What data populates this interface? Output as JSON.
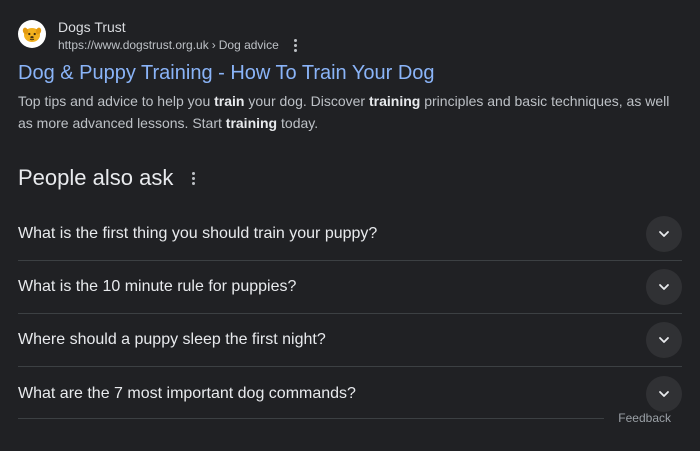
{
  "result": {
    "site_name": "Dogs Trust",
    "url": "https://www.dogstrust.org.uk",
    "url_separator": "›",
    "breadcrumb": "Dog advice",
    "title": "Dog & Puppy Training - How To Train Your Dog",
    "snippet_parts": [
      {
        "text": "Top tips and advice to help you ",
        "bold": false
      },
      {
        "text": "train",
        "bold": true
      },
      {
        "text": " your dog. Discover ",
        "bold": false
      },
      {
        "text": "training",
        "bold": true
      },
      {
        "text": " principles and basic techniques, as well as more advanced lessons. Start ",
        "bold": false
      },
      {
        "text": "training",
        "bold": true
      },
      {
        "text": " today.",
        "bold": false
      }
    ]
  },
  "people_also_ask": {
    "title": "People also ask",
    "questions": [
      "What is the first thing you should train your puppy?",
      "What is the 10 minute rule for puppies?",
      "Where should a puppy sleep the first night?",
      "What are the 7 most important dog commands?"
    ]
  },
  "feedback_label": "Feedback",
  "icons": {
    "favicon": "dog-face-icon",
    "more": "more-vert-icon",
    "expand": "chevron-down-icon"
  },
  "colors": {
    "background": "#202124",
    "link": "#8ab4f8",
    "text": "#bdc1c6",
    "heading": "#e8eaed"
  }
}
